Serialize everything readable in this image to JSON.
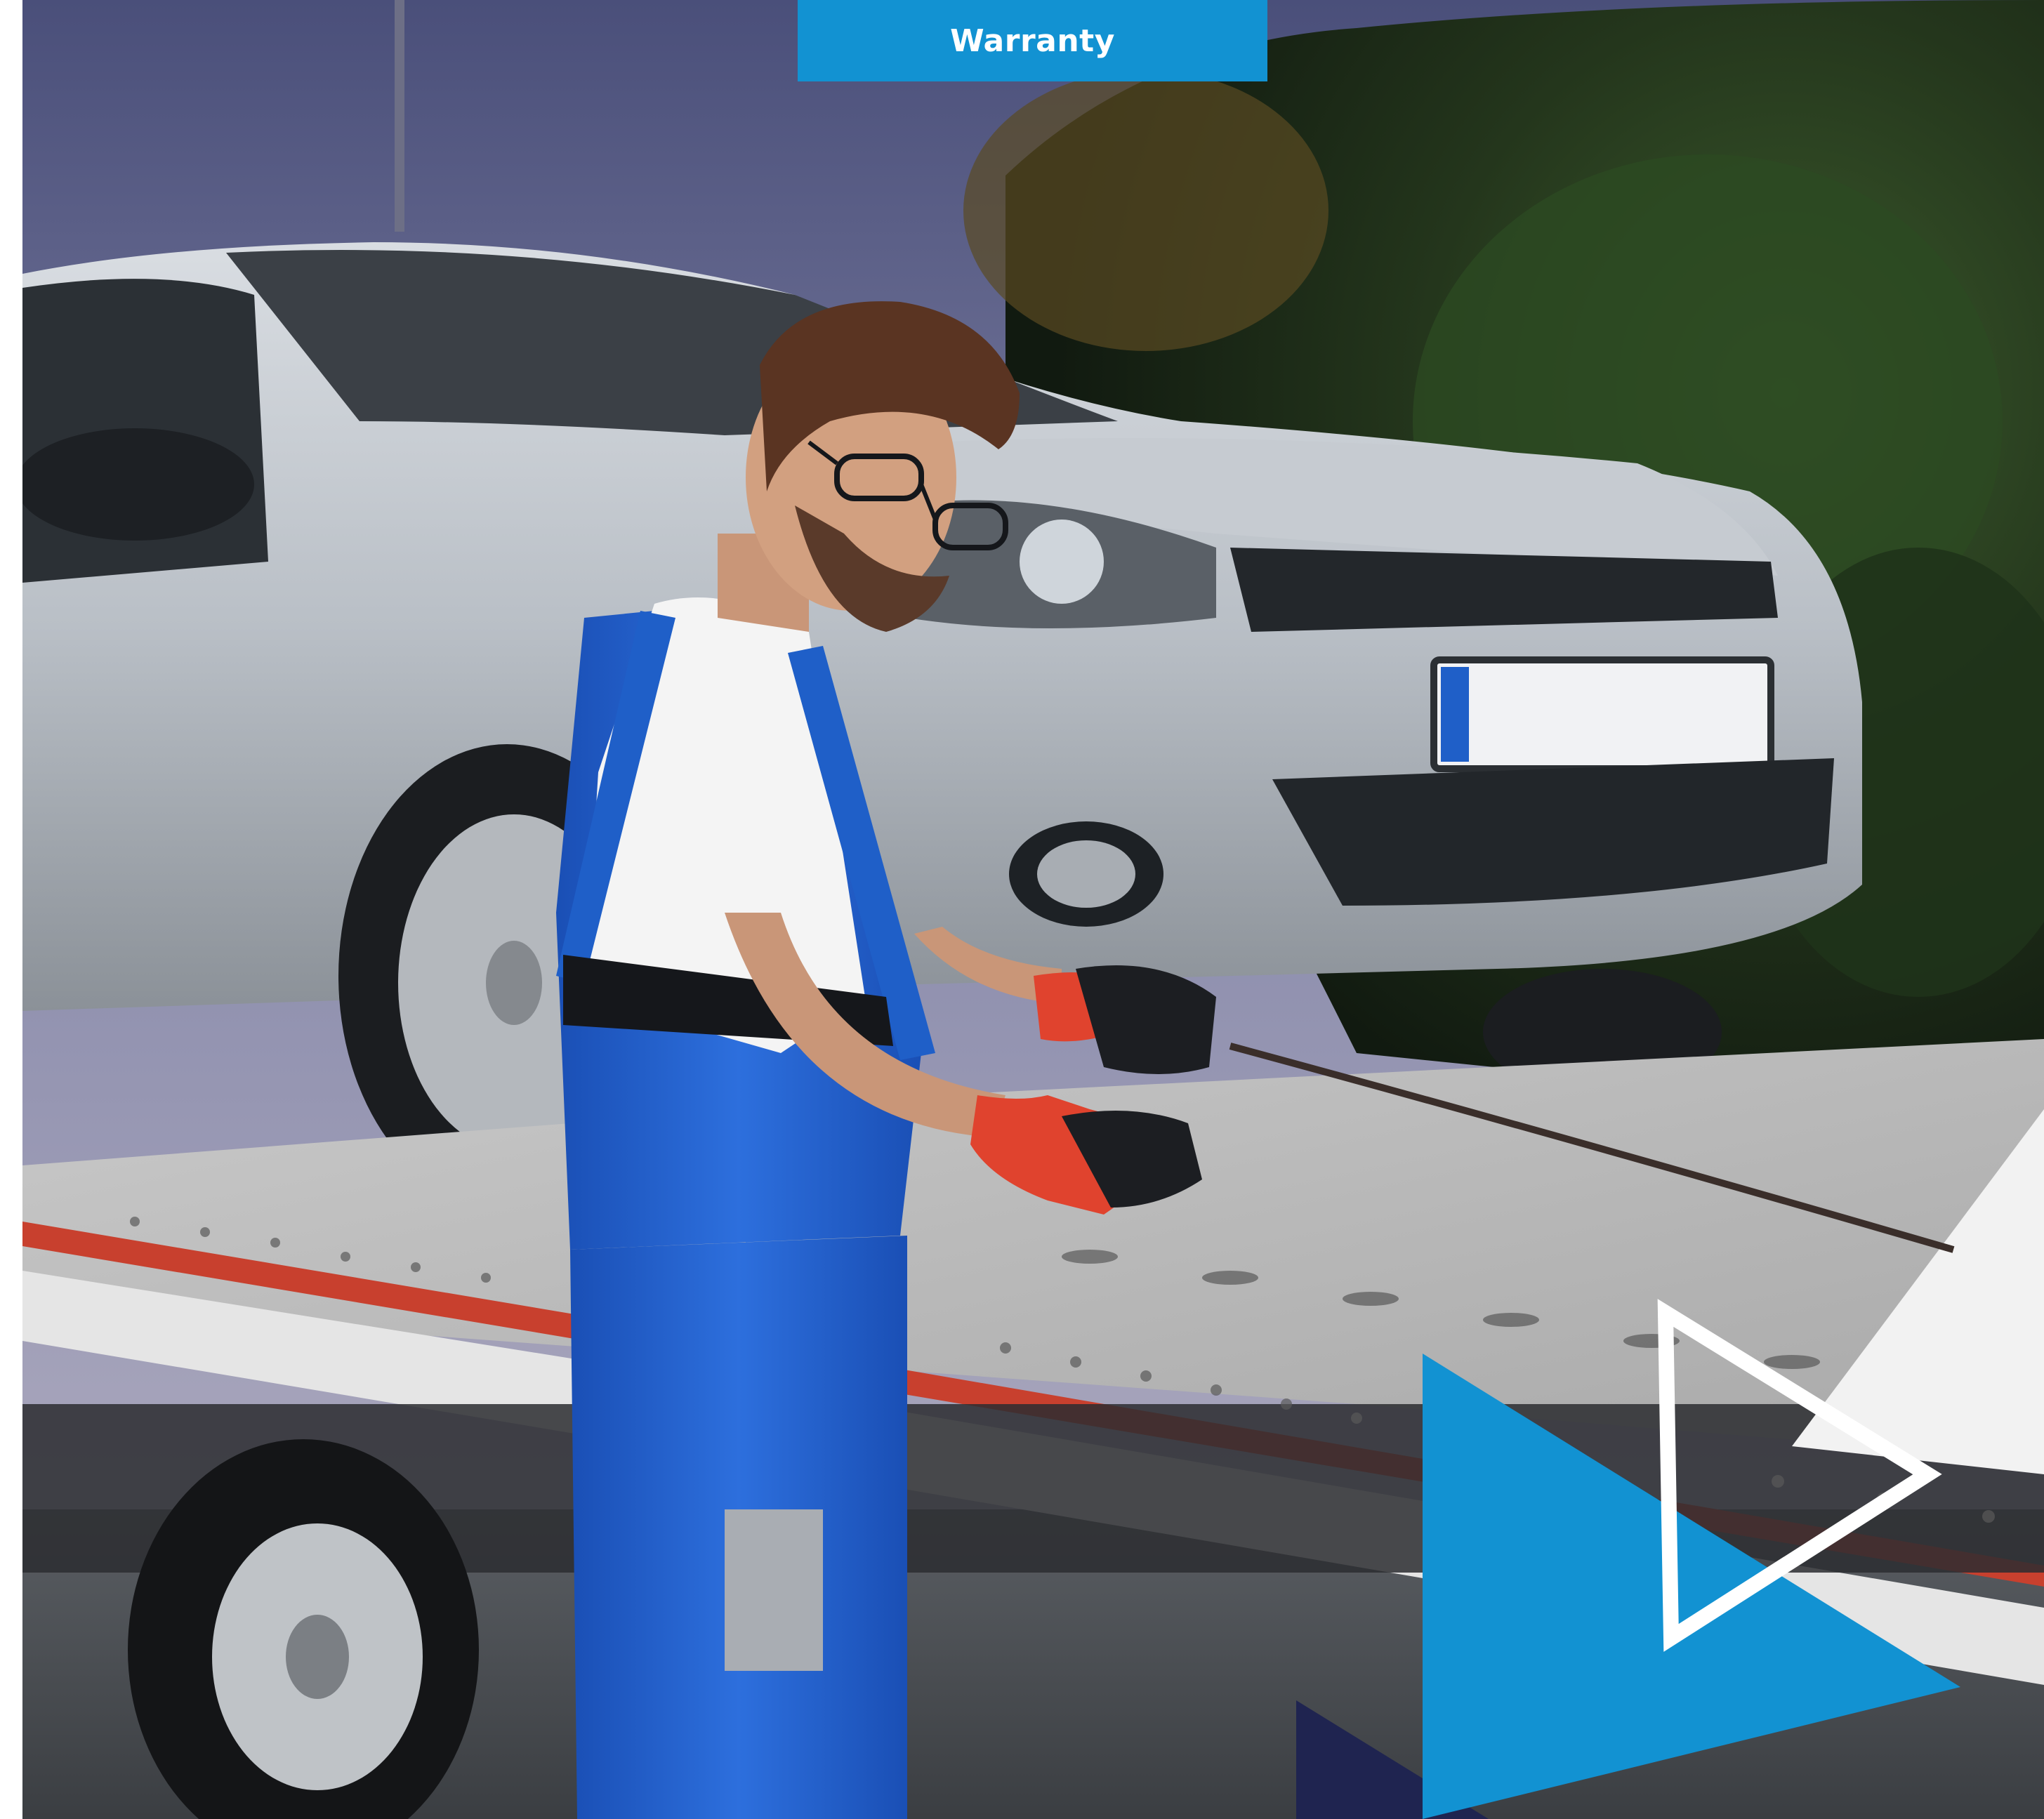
{
  "tab": {
    "label": "Warranty"
  },
  "colors": {
    "brand_blue": "#1292d2",
    "navy": "#1f2450",
    "white": "#ffffff",
    "overall_blue": "#1f5fc8"
  },
  "icons": {
    "play_outline": "play-outline-icon",
    "brand_triangle": "brand-triangle-icon"
  }
}
